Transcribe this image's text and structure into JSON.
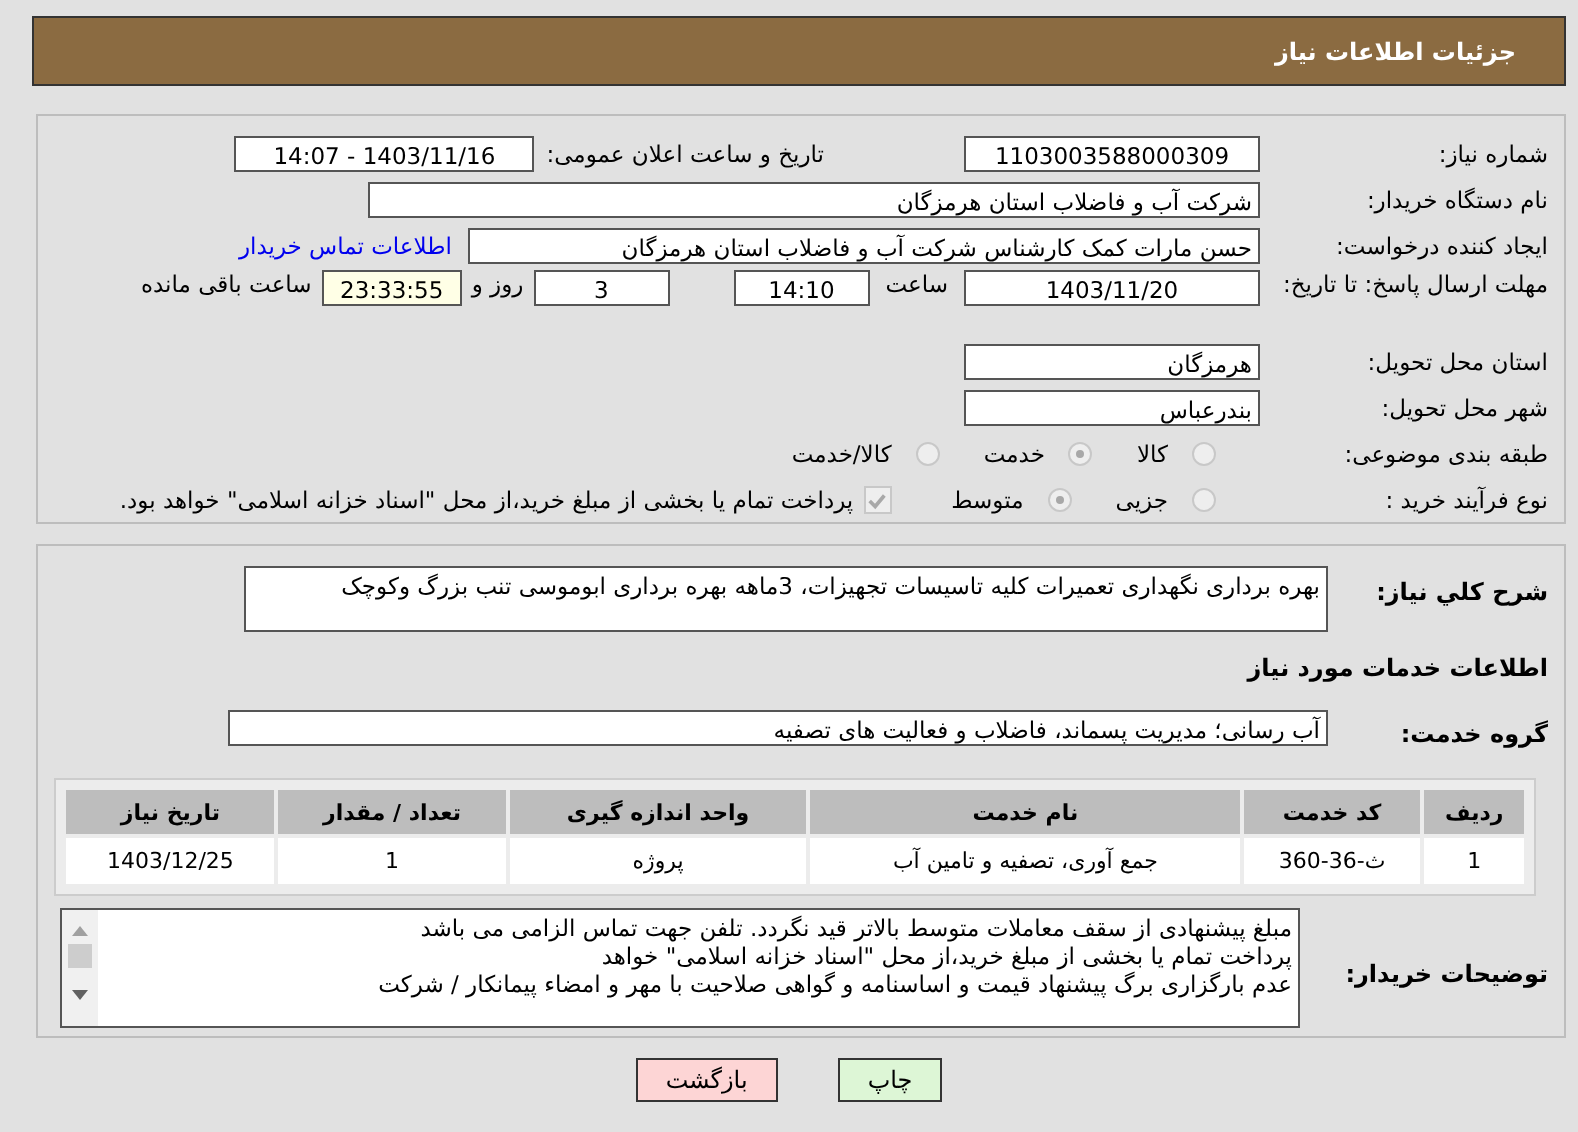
{
  "header": {
    "title": "جزئیات اطلاعات نیاز"
  },
  "need_number": {
    "label": "شماره نیاز:",
    "value": "1103003588000309"
  },
  "announce": {
    "label": "تاریخ و ساعت اعلان عمومی:",
    "value": "1403/11/16 - 14:07"
  },
  "buyer": {
    "label": "نام دستگاه خریدار:",
    "value": "شرکت آب و فاضلاب استان هرمزگان"
  },
  "creator": {
    "label": "ایجاد کننده درخواست:",
    "value": "حسن مارات کمک کارشناس شرکت آب و فاضلاب استان هرمزگان",
    "link": "اطلاعات تماس خریدار"
  },
  "deadline": {
    "label": "مهلت ارسال پاسخ: تا تاریخ:",
    "date": "1403/11/20",
    "time_label": "ساعت",
    "time": "14:10",
    "days": "3",
    "days_label": "روز و",
    "remaining": "23:33:55",
    "remaining_label": "ساعت باقی مانده"
  },
  "province": {
    "label": "استان محل تحویل:",
    "value": "هرمزگان"
  },
  "city": {
    "label": "شهر محل تحویل:",
    "value": "بندرعباس"
  },
  "category": {
    "label": "طبقه بندی موضوعی:",
    "options": [
      {
        "label": "کالا",
        "selected": false
      },
      {
        "label": "خدمت",
        "selected": true
      },
      {
        "label": "کالا/خدمت",
        "selected": false
      }
    ]
  },
  "process": {
    "label": "نوع فرآیند خرید :",
    "options": [
      {
        "label": "جزیی",
        "selected": false
      },
      {
        "label": "متوسط",
        "selected": true
      }
    ],
    "payment_checked": true,
    "payment_text": "پرداخت تمام یا بخشی از مبلغ خرید،از محل \"اسناد خزانه اسلامی\" خواهد بود."
  },
  "description": {
    "label": "شرح کلي نياز:",
    "value": "بهره برداری نگهداری تعمیرات کلیه تاسیسات تجهیزات، 3ماهه بهره برداری ابوموسی تنب بزرگ وکوچک"
  },
  "services_title": "اطلاعات خدمات مورد نیاز",
  "service_group": {
    "label": "گروه خدمت:",
    "value": "آب رسانی؛ مدیریت پسماند، فاضلاب و فعالیت های تصفیه"
  },
  "table": {
    "columns": [
      "ردیف",
      "کد خدمت",
      "نام خدمت",
      "واحد اندازه گیری",
      "تعداد / مقدار",
      "تاریخ نیاز"
    ],
    "rows": [
      [
        "1",
        "ث-36-360",
        "جمع آوری، تصفیه و تامین آب",
        "پروژه",
        "1",
        "1403/12/25"
      ]
    ]
  },
  "buyer_notes": {
    "label": "توضیحات خریدار:",
    "lines": [
      "مبلغ پیشنهادی از سقف معاملات متوسط بالاتر قید نگردد. تلفن جهت تماس الزامی می باشد",
      "پرداخت تمام یا بخشی از مبلغ خرید،از محل \"اسناد خزانه اسلامی\" خواهد",
      "عدم بارگزاری برگ پیشنهاد قیمت و اساسنامه و گواهی صلاحیت با مهر و امضاء پیمانکار / شرکت"
    ]
  },
  "buttons": [
    {
      "label": "چاپ",
      "kind": "print"
    },
    {
      "label": "بازگشت",
      "kind": "back"
    }
  ]
}
